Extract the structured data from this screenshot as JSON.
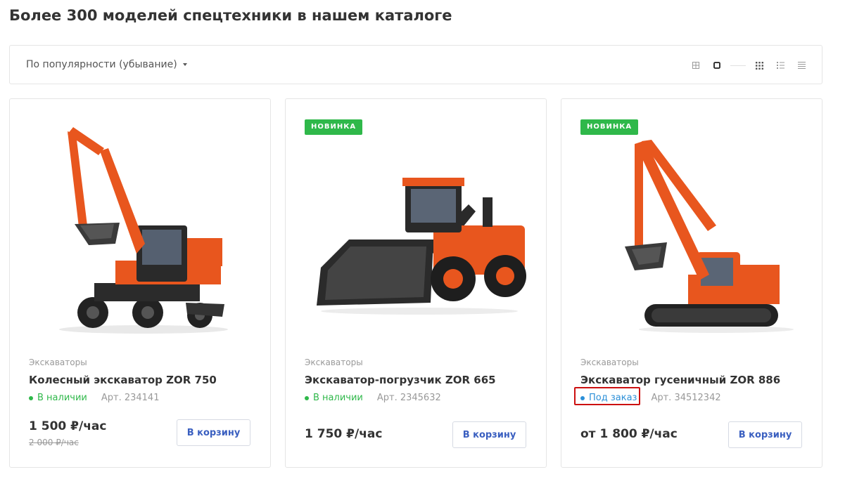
{
  "page": {
    "title": "Более 300 моделей спецтехники в нашем каталоге"
  },
  "toolbar": {
    "sort_label": "По популярности (убывание)",
    "view_icons": [
      "grid-small-icon",
      "grid-large-icon",
      "grid-dense-icon",
      "list-icon",
      "list-compact-icon"
    ]
  },
  "colors": {
    "accent": "#2fb84a",
    "link_blue": "#2b8fd8",
    "button_text": "#3a5fc0",
    "machine_orange": "#e8561e",
    "highlight_red": "#cc1010"
  },
  "products": [
    {
      "badge": "",
      "category": "Экскаваторы",
      "name": "Колесный экскаватор ZOR 750",
      "status": "В наличии",
      "article": "Арт. 234141",
      "price": "1 500 ₽/час",
      "old_price": "2 000 ₽/час",
      "button": "В корзину",
      "image": "wheeled-excavator"
    },
    {
      "badge": "НОВИНКА",
      "category": "Экскаваторы",
      "name": "Экскаватор-погрузчик ZOR 665",
      "status": "В наличии",
      "article": "Арт. 2345632",
      "price": "1 750 ₽/час",
      "old_price": "",
      "button": "В корзину",
      "image": "wheel-loader"
    },
    {
      "badge": "НОВИНКА",
      "category": "Экскаваторы",
      "name": "Экскаватор гусеничный ZOR 886",
      "status": "Под заказ",
      "article": "Арт. 34512342",
      "price": "от 1 800 ₽/час",
      "old_price": "",
      "button": "В корзину",
      "image": "crawler-excavator"
    }
  ]
}
